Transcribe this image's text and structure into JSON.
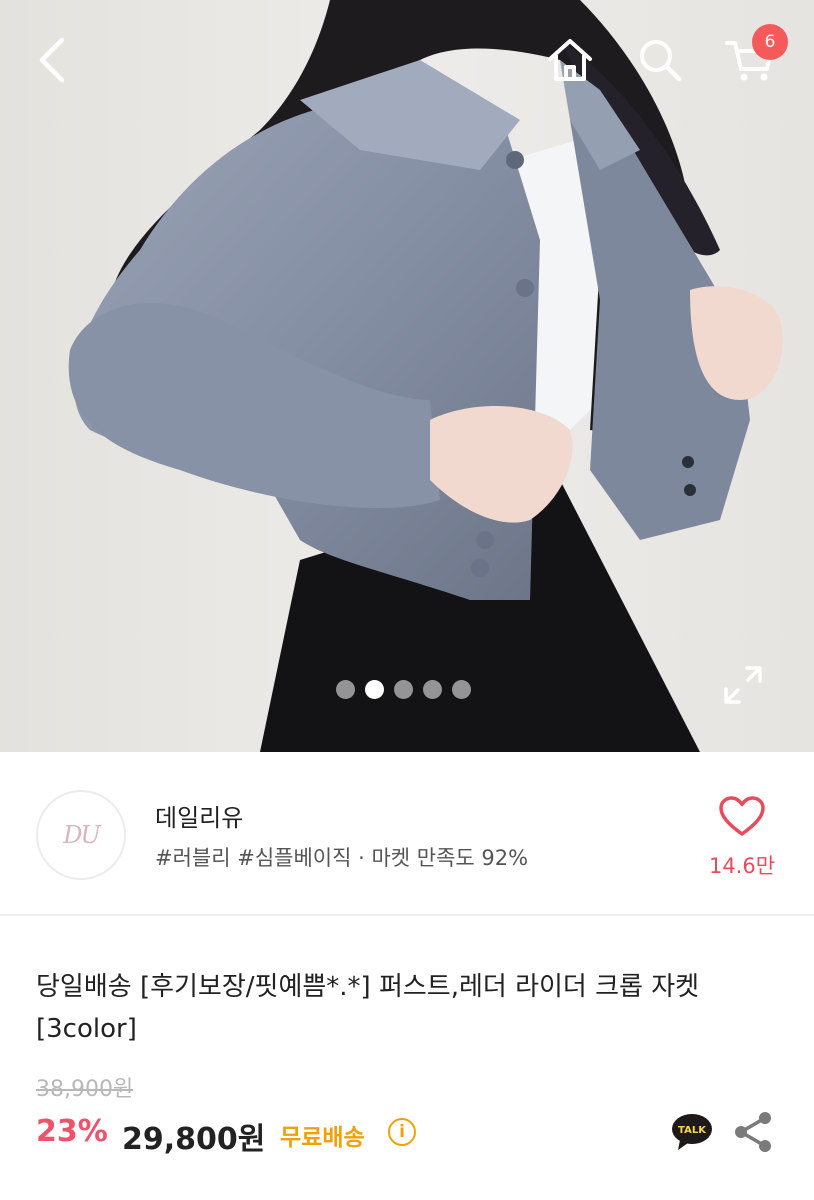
{
  "header": {
    "back_icon": "chevron-left-icon",
    "home_icon": "home-icon",
    "search_icon": "search-icon",
    "cart_icon": "cart-icon",
    "cart_count": "6"
  },
  "gallery": {
    "slide_count": 5,
    "active_slide": 2,
    "expand_icon": "expand-icon"
  },
  "seller": {
    "logo_text": "DU",
    "name": "데일리유",
    "tags": "#러블리 #심플베이직 · 마켓 만족도 92%",
    "like_count": "14.6만"
  },
  "product": {
    "title": "당일배송 [후기보장/핏예쁨*.*] 퍼스트,레더 라이더 크롭 자켓 [3color]",
    "original_price": "38,900원",
    "discount": "23%",
    "price": "29,800원",
    "shipping": "무료배송",
    "info_icon_text": "i",
    "talk_label": "TALK"
  },
  "colors": {
    "accent_red": "#f0516b",
    "shipping_orange": "#f0a10a",
    "badge_red": "#f55a5a"
  }
}
